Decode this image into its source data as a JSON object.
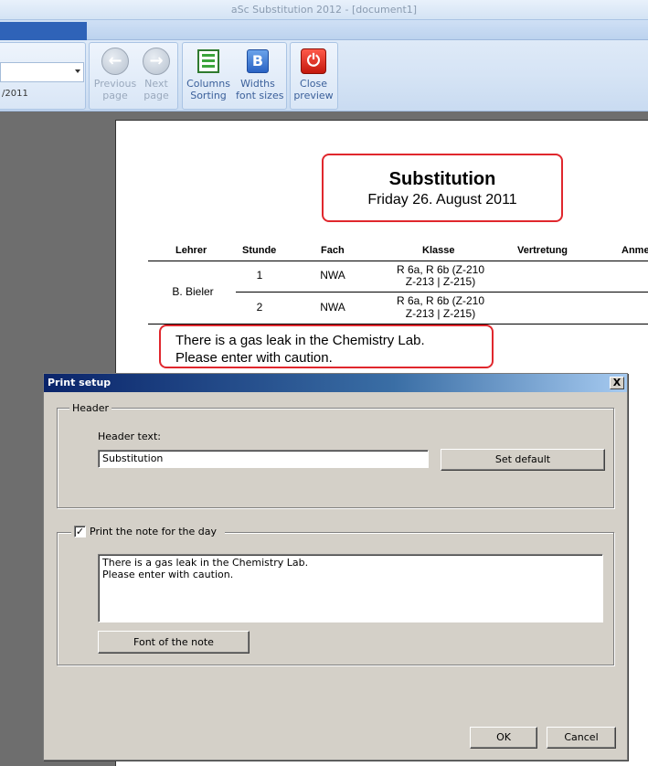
{
  "window": {
    "title": "aSc Substitution 2012  - [document1]"
  },
  "ribbon": {
    "date_partial": "/2011",
    "buttons": {
      "previous_page": [
        "Previous",
        "page"
      ],
      "next_page": [
        "Next",
        "page"
      ],
      "columns_sorting": [
        "Columns",
        "Sorting"
      ],
      "widths_font_sizes": [
        "Widths",
        "font sizes"
      ],
      "close_preview": [
        "Close",
        "preview"
      ]
    }
  },
  "preview": {
    "title": "Substitution",
    "subtitle": "Friday 26. August 2011",
    "columns": [
      "Lehrer",
      "Stunde",
      "Fach",
      "Klasse",
      "Vertretung",
      "Anme"
    ],
    "teacher": "B. Bieler",
    "rows": [
      {
        "stunde": "1",
        "fach": "NWA",
        "klasse_line1": "R 6a, R 6b (Z-210",
        "klasse_line2": "Z-213 | Z-215)"
      },
      {
        "stunde": "2",
        "fach": "NWA",
        "klasse_line1": "R 6a, R 6b (Z-210",
        "klasse_line2": "Z-213 | Z-215)"
      }
    ],
    "note_line1": "There is a gas leak in the Chemistry Lab.",
    "note_line2": "Please enter with caution."
  },
  "dialog": {
    "title": "Print setup",
    "close_glyph": "X",
    "header_group": "Header",
    "header_text_label": "Header text:",
    "header_text_value": "Substitution",
    "set_default": "Set default",
    "note_checkbox_label": "Print the note for the day",
    "note_checked": true,
    "note_line1": "There is a gas leak in the Chemistry Lab.",
    "note_line2": "Please enter with caution.",
    "font_button": "Font of the note",
    "ok": "OK",
    "cancel": "Cancel"
  }
}
